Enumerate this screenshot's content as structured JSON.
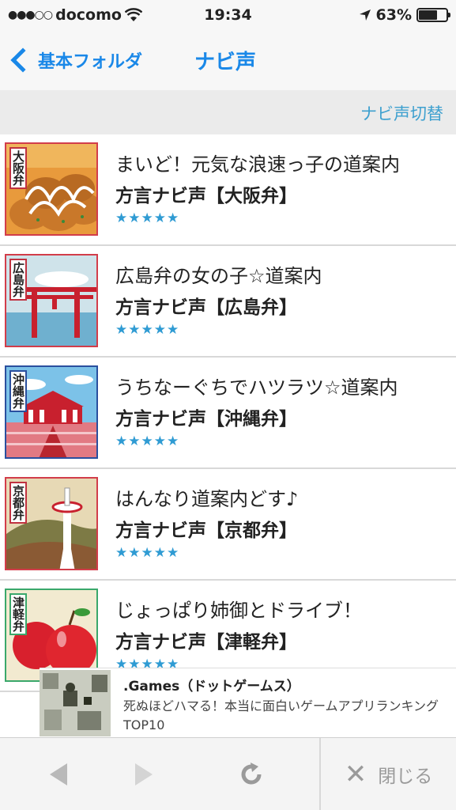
{
  "status_bar": {
    "carrier": "docomo",
    "time": "19:34",
    "battery_percent": "63%",
    "battery_level": 0.63,
    "icons": [
      "signal-dots-icon",
      "wifi-icon",
      "location-arrow-icon",
      "battery-icon"
    ]
  },
  "nav": {
    "back_label": "基本フォルダ",
    "title": "ナビ声"
  },
  "toolbar": {
    "switch_label": "ナビ声切替"
  },
  "items": [
    {
      "tag": "大阪弁",
      "title": "まいど！元気な浪速っ子の道案内",
      "subtitle": "方言ナビ声【大阪弁】",
      "stars": "★★★★★",
      "rating": 5,
      "border_color": "#d23d4a"
    },
    {
      "tag": "広島弁",
      "title": "広島弁の女の子☆道案内",
      "subtitle": "方言ナビ声【広島弁】",
      "stars": "★★★★★",
      "rating": 5,
      "border_color": "#d23d4a"
    },
    {
      "tag": "沖縄弁",
      "title": "うちなーぐちでハツラツ☆道案内",
      "subtitle": "方言ナビ声【沖縄弁】",
      "stars": "★★★★★",
      "rating": 5,
      "border_color": "#2a4f9e"
    },
    {
      "tag": "京都弁",
      "title": "はんなり道案内どす♪",
      "subtitle": "方言ナビ声【京都弁】",
      "stars": "★★★★★",
      "rating": 5,
      "border_color": "#d23d4a"
    },
    {
      "tag": "津軽弁",
      "title": "じょっぱり姉御とドライブ！",
      "subtitle": "方言ナビ声【津軽弁】",
      "stars": "★★★★★",
      "rating": 5,
      "border_color": "#3aa86b"
    }
  ],
  "ad": {
    "title": ".Games（ドットゲームス）",
    "text": "死ぬほどハマる！本当に面白いゲームアプリランキングTOP10"
  },
  "bottom": {
    "close_label": "閉じる"
  }
}
